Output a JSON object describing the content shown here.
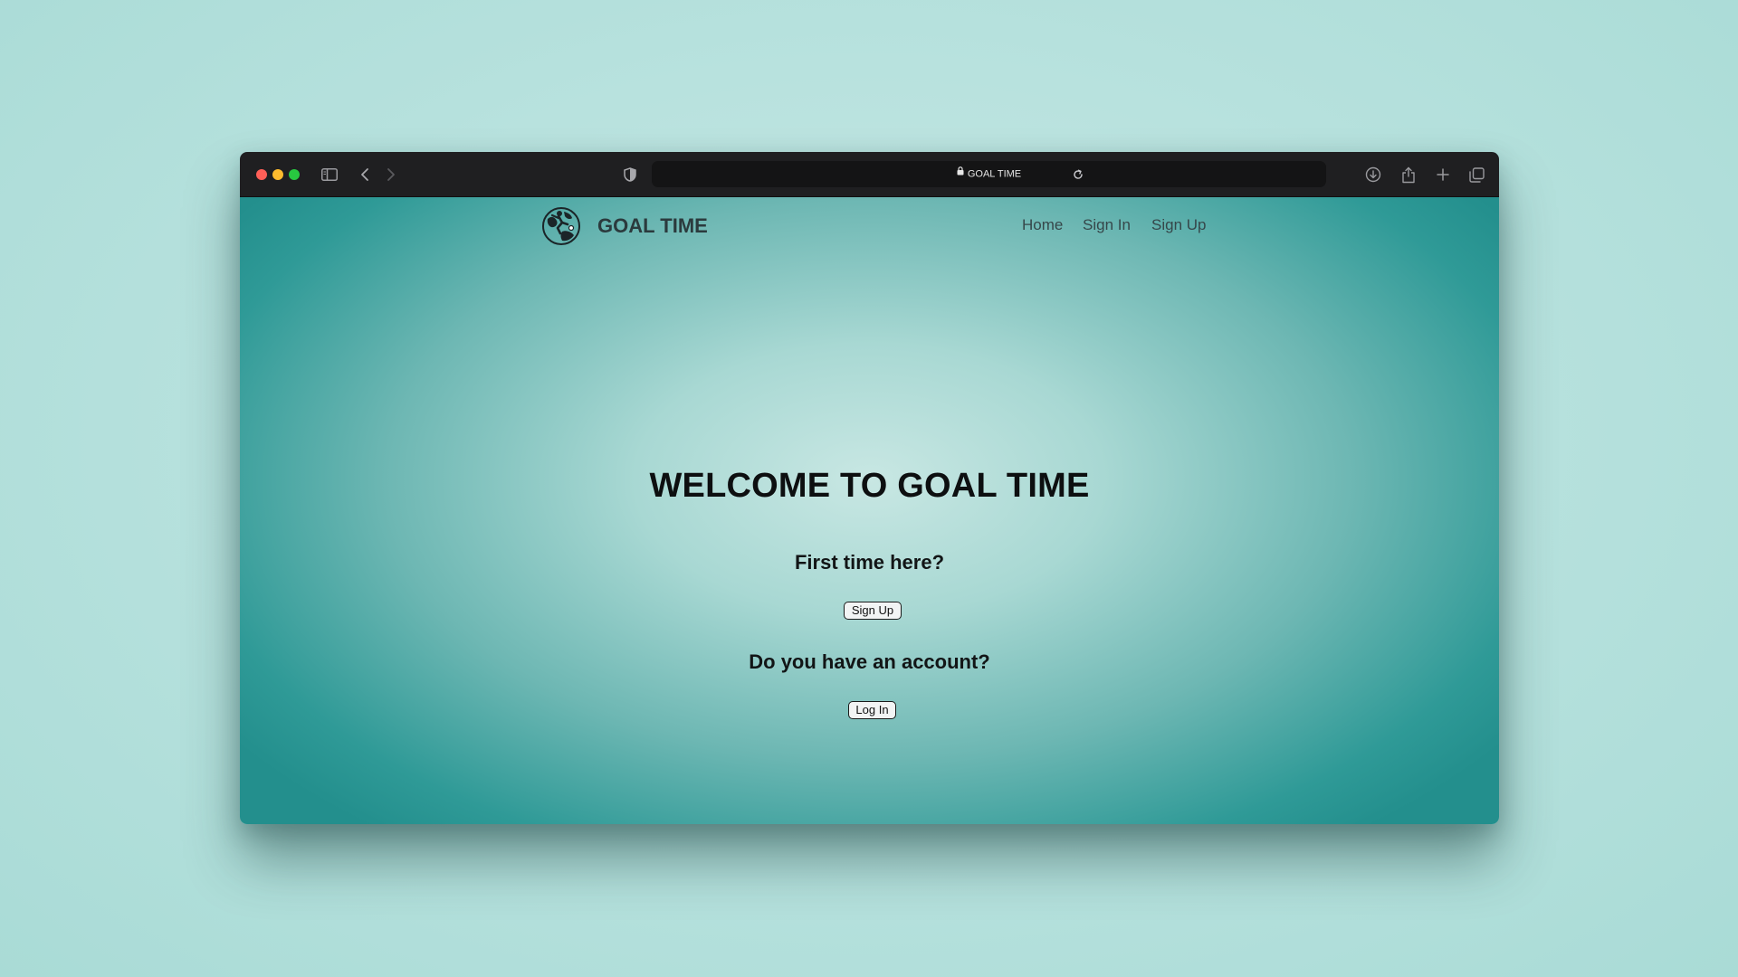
{
  "browser": {
    "url_title": "GOAL TIME",
    "icons": [
      "sidebar-icon",
      "back-icon",
      "forward-icon",
      "privacy-shield-icon",
      "lock-icon",
      "reload-icon",
      "download-icon",
      "share-icon",
      "new-tab-icon",
      "tab-overview-icon"
    ]
  },
  "nav": {
    "brand": "GOAL TIME",
    "links": [
      "Home",
      "Sign In",
      "Sign Up"
    ]
  },
  "hero": {
    "title": "WELCOME TO GOAL TIME",
    "first_time_question": "First time here?",
    "signup_button": "Sign Up",
    "account_question": "Do you have an account?",
    "login_button": "Log In"
  },
  "colors": {
    "page_background": "#b6e1dd",
    "toolbar": "#1f1f21",
    "content_center": "#c8e7e3",
    "content_edge": "#238f8d"
  }
}
